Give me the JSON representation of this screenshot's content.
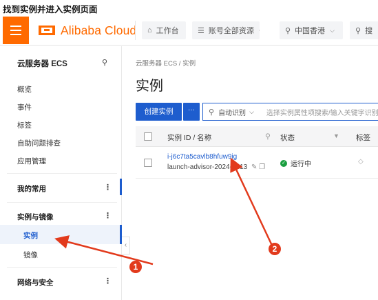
{
  "caption": "找到实例并进入实例页面",
  "topbar": {
    "logo": "Alibaba Cloud",
    "workbench": "工作台",
    "account_resources": "账号全部资源",
    "region": "中国香港",
    "search_partial": "搜"
  },
  "sidebar": {
    "title": "云服务器 ECS",
    "items": [
      "概览",
      "事件",
      "标签",
      "自助问题排查",
      "应用管理"
    ],
    "group_favorites": "我的常用",
    "group_instances": "实例与镜像",
    "sub_instances": "实例",
    "sub_images": "镜像",
    "group_network": "网络与安全",
    "collapse": "‹"
  },
  "main": {
    "breadcrumb": "云服务器 ECS  /  实例",
    "title": "实例",
    "create_button": "创建实例",
    "more_button": "···",
    "search_type": "自动识别",
    "search_placeholder": "选择实例属性项搜索/输入关键字识别搜索",
    "columns": {
      "id_name": "实例 ID / 名称",
      "status": "状态",
      "tags": "标签"
    },
    "rows": [
      {
        "id": "i-j6c7ta5cavlb8hfuw9ig",
        "name": "launch-advisor-2024-0813",
        "status": "运行中"
      }
    ]
  },
  "annotations": {
    "marker1": "1",
    "marker2": "2",
    "color": "#e23a1c"
  },
  "colors": {
    "brand_orange": "#ff6a00",
    "primary_blue": "#1e5dce",
    "running_green": "#1a9e3f"
  }
}
